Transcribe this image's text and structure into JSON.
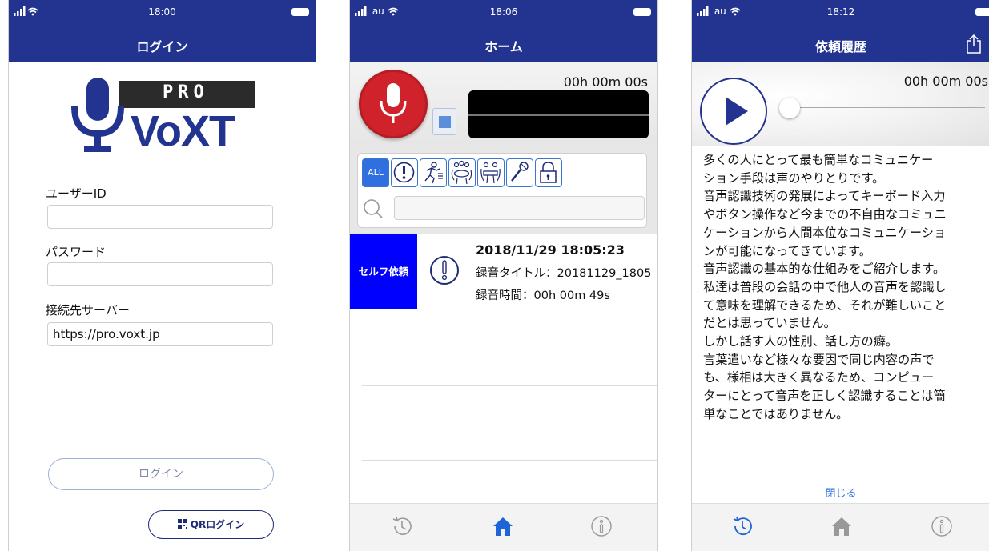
{
  "screens": {
    "login": {
      "status": {
        "carrier": "",
        "time": "18:00"
      },
      "title": "ログイン",
      "logo": {
        "badge": "PRO",
        "wordmark": "VoXT"
      },
      "user_id_label": "ユーザーID",
      "user_id_value": "",
      "password_label": "パスワード",
      "password_value": "",
      "server_label": "接続先サーバー",
      "server_value": "https://pro.voxt.jp",
      "login_button": "ログイン",
      "qr_button": "QRログイン"
    },
    "home": {
      "status": {
        "carrier": "au",
        "time": "18:06"
      },
      "title": "ホーム",
      "timer": "00h 00m 00s",
      "filters": {
        "all_label": "ALL",
        "icons": [
          "exclamation-icon",
          "running-person-icon",
          "meeting-group-icon",
          "meeting-pair-icon",
          "microphone-icon",
          "lock-icon"
        ]
      },
      "search_value": "",
      "item": {
        "tag": "セルフ依頼",
        "datetime": "2018/11/29 18:05:23",
        "title_line": "録音タイトル：20181129_1805",
        "duration_line": "録音時間：00h 00m 49s"
      },
      "tabs": [
        "history-icon",
        "home-icon",
        "info-icon"
      ]
    },
    "history": {
      "status": {
        "carrier": "au",
        "time": "18:12"
      },
      "title": "依頼履歴",
      "timer": "00h 00m 00s",
      "transcript_lines": [
        "多くの人にとって最も簡単なコミュニケー",
        "ション手段は声のやりとりです。",
        "音声認識技術の発展によってキーボード入力",
        "やボタン操作など今までの不自由なコミュニ",
        "ケーションから人間本位なコミュニケーショ",
        "ンが可能になってきています。",
        "音声認識の基本的な仕組みをご紹介します。",
        "私達は普段の会話の中で他人の音声を認識し",
        "て意味を理解できるため、それが難しいこと",
        "だとは思っていません。",
        "しかし話す人の性別、話し方の癖。",
        "言葉遣いなど様々な要因で同じ内容の声で",
        "も、様相は大きく異なるため、コンピュー",
        "ターにとって音声を正しく認識することは簡",
        "単なことではありません。"
      ],
      "close_label": "閉じる",
      "tabs": [
        "history-icon",
        "home-icon",
        "info-icon"
      ]
    }
  },
  "colors": {
    "navbar": "#233490",
    "accent_blue": "#2f6fe0",
    "tag_blue": "#0000ff",
    "record_red": "#d0222a"
  }
}
